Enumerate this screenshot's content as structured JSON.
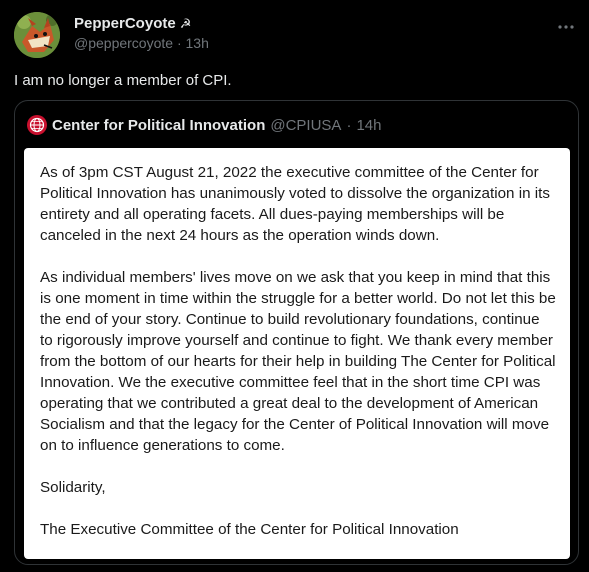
{
  "author": {
    "display_name": "PepperCoyote",
    "name_emoji": "☭",
    "handle": "@peppercoyote",
    "time": "13h"
  },
  "tweet": {
    "text": "I am no longer a member of CPI."
  },
  "quote": {
    "display_name": "Center for Political Innovation",
    "handle": "@CPIUSA",
    "time": "14h",
    "image_text": {
      "p1": "As of 3pm CST August 21, 2022 the executive committee of the Center for Political Innovation has unanimously voted to dissolve the organization in its entirety and all operating facets. All dues-paying memberships will be canceled in the next 24 hours as the operation winds down.",
      "p2": "As individual members' lives move on we ask that you keep in mind that this is one moment in time within the struggle for a better world. Do not let this be the end of your story. Continue to build revolutionary foundations, continue to rigorously improve yourself and continue to fight. We thank every member from the bottom of our hearts for their help in building The Center for Political Innovation. We the executive committee feel that in the short time CPI was operating that we contributed a great deal to the development of American Socialism and that the legacy for the Center of Political Innovation will move on to influence generations to come.",
      "p3": "Solidarity,",
      "p4": "The Executive Committee of the Center for Political Innovation"
    }
  },
  "icons": {
    "more": "more-icon",
    "avatar": "coyote-avatar",
    "quote_avatar": "cpi-globe-logo"
  },
  "colors": {
    "background": "#000000",
    "text_primary": "#e7e9ea",
    "text_secondary": "#71767b",
    "border": "#2f3336",
    "cpi_red": "#c8102e"
  }
}
